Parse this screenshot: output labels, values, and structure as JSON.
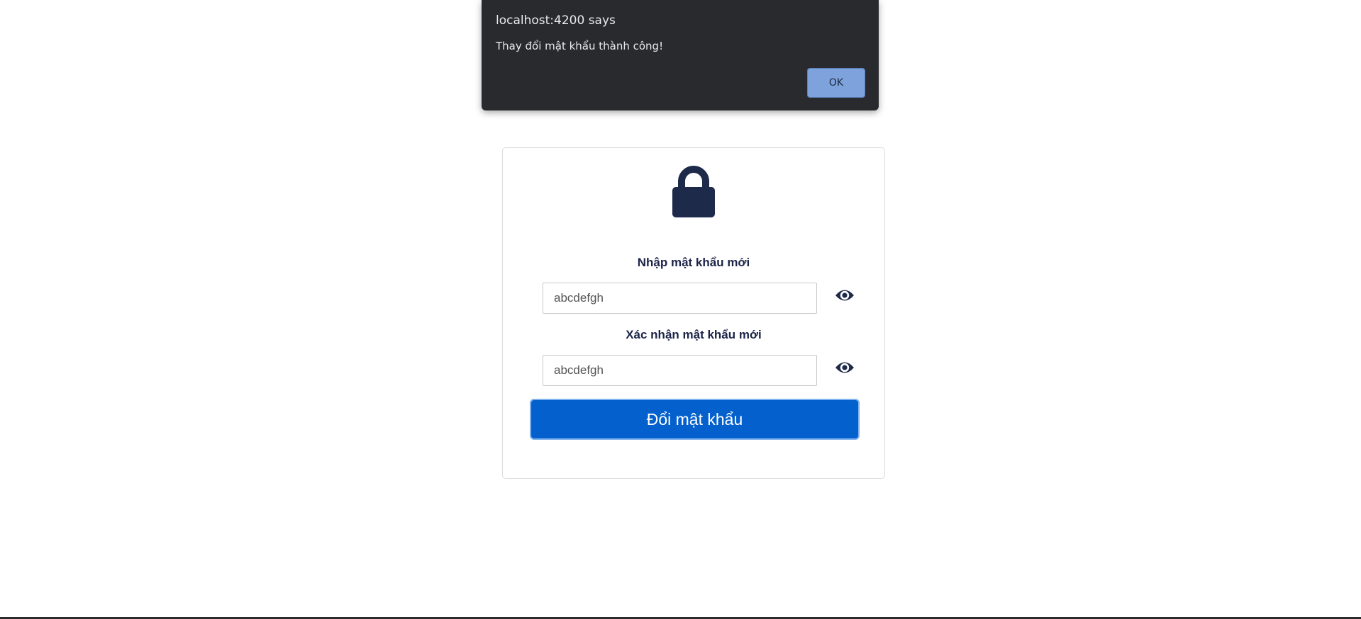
{
  "alert": {
    "title": "localhost:4200 says",
    "message": "Thay đổi mật khẩu thành công!",
    "ok_label": "OK"
  },
  "form": {
    "lock_icon": "lock-icon",
    "new_password": {
      "label": "Nhập mật khẩu mới",
      "value": "abcdefgh",
      "toggle_icon": "eye-icon"
    },
    "confirm_password": {
      "label": "Xác nhận mật khẩu mới",
      "value": "abcdefgh",
      "toggle_icon": "eye-icon"
    },
    "submit_label": "Đổi mật khẩu"
  },
  "colors": {
    "alert_background": "#292a2d",
    "alert_ok_button": "#7ea2db",
    "icon_navy": "#1e2a4a",
    "label_text": "#1b2447",
    "submit_button": "#0460cc"
  }
}
